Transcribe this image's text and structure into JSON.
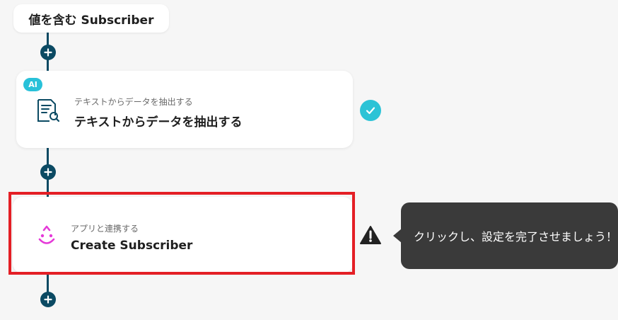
{
  "trigger": {
    "label": "値を含む Subscriber"
  },
  "steps": [
    {
      "badge": "AI",
      "subtitle": "テキストからデータを抽出する",
      "title": "テキストからデータを抽出する",
      "icon": "document-search-icon",
      "status": "completed",
      "status_icon": "check-icon"
    },
    {
      "subtitle": "アプリと連携する",
      "title": "Create Subscriber",
      "icon": "smile-drop-icon",
      "status": "warning",
      "status_icon": "warning-icon",
      "highlighted": true
    }
  ],
  "tooltip": {
    "text": "クリックし、設定を完了させましょう！"
  },
  "colors": {
    "connector": "#0b4a63",
    "ai_badge": "#28c1d9",
    "check": "#2cc3d6",
    "highlight": "#e41f25",
    "tooltip_bg": "#3a3a3a",
    "app_icon": "#e53ad8"
  },
  "add_buttons": 3
}
